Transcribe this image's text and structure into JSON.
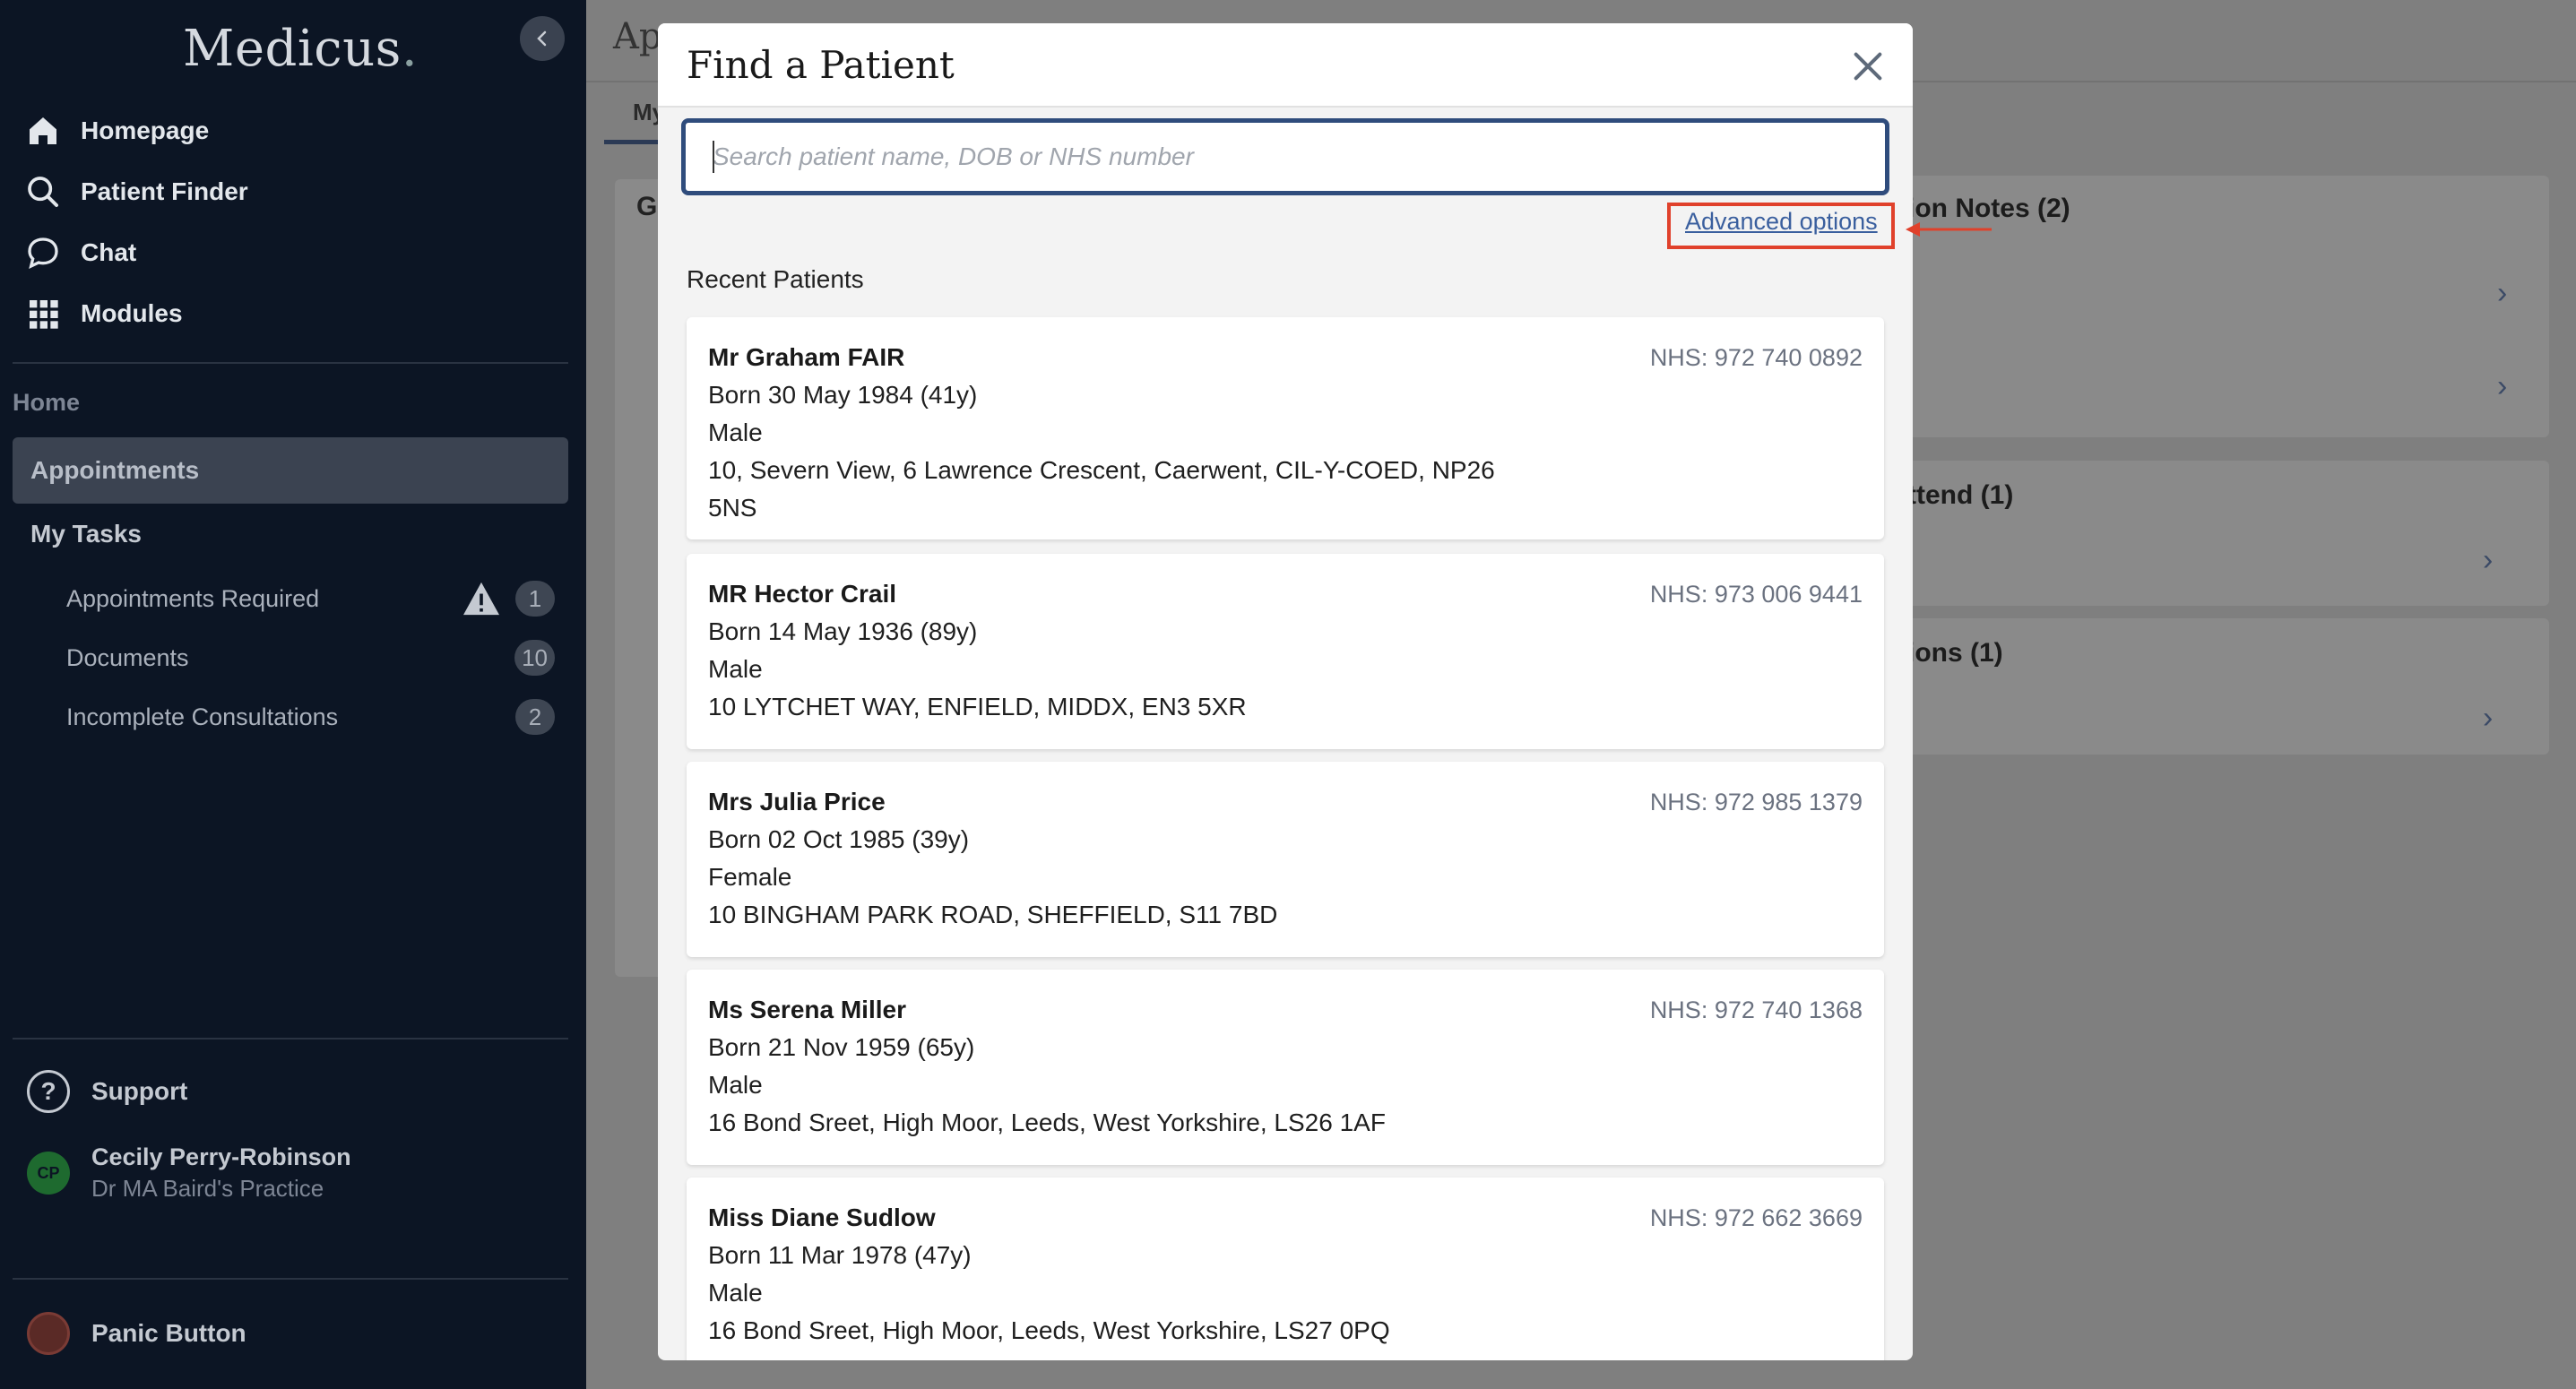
{
  "sidebar": {
    "logo": "Medicus",
    "logo_dot": ".",
    "nav": [
      {
        "label": "Homepage",
        "icon": "home-icon"
      },
      {
        "label": "Patient Finder",
        "icon": "search-icon"
      },
      {
        "label": "Chat",
        "icon": "chat-icon"
      },
      {
        "label": "Modules",
        "icon": "grid-icon"
      }
    ],
    "section_home": "Home",
    "active_item": "Appointments",
    "tasks_heading": "My Tasks",
    "tasks": [
      {
        "label": "Appointments Required",
        "count": "1"
      },
      {
        "label": "Documents",
        "count": "10"
      },
      {
        "label": "Incomplete Consultations",
        "count": "2"
      }
    ],
    "support": "Support",
    "user": {
      "initials": "CP",
      "name": "Cecily Perry-Robinson",
      "practice": "Dr MA Baird's Practice"
    },
    "panic": "Panic Button"
  },
  "background": {
    "title": "Ap",
    "tab": "My",
    "left_card_initial": "G",
    "cards": [
      {
        "title": "ion Notes (2)"
      },
      {
        "title": "ttend (1)"
      },
      {
        "title": "ions (1)"
      }
    ]
  },
  "modal": {
    "title": "Find a Patient",
    "search_placeholder": "Search patient name, DOB or NHS number",
    "advanced_options": "Advanced options",
    "recent_label": "Recent Patients",
    "patients": [
      {
        "name": "Mr Graham FAIR",
        "nhs": "NHS: 972 740 0892",
        "born": "Born 30 May 1984 (41y)",
        "gender": "Male",
        "address": "10, Severn View, 6 Lawrence Crescent, Caerwent, CIL-Y-COED, NP26 5NS"
      },
      {
        "name": "MR Hector Crail",
        "nhs": "NHS: 973 006 9441",
        "born": "Born 14 May 1936 (89y)",
        "gender": "Male",
        "address": "10 LYTCHET WAY, ENFIELD, MIDDX, EN3 5XR"
      },
      {
        "name": "Mrs Julia Price",
        "nhs": "NHS: 972 985 1379",
        "born": "Born 02 Oct 1985 (39y)",
        "gender": "Female",
        "address": "10 BINGHAM PARK ROAD, SHEFFIELD, S11 7BD"
      },
      {
        "name": "Ms Serena Miller",
        "nhs": "NHS: 972 740 1368",
        "born": "Born 21 Nov 1959 (65y)",
        "gender": "Male",
        "address": "16 Bond Sreet, High Moor, Leeds, West Yorkshire, LS26 1AF"
      },
      {
        "name": "Miss Diane Sudlow",
        "nhs": "NHS: 972 662 3669",
        "born": "Born 11 Mar 1978 (47y)",
        "gender": "Male",
        "address": "16 Bond Sreet, High Moor, Leeds, West Yorkshire, LS27 0PQ"
      }
    ]
  },
  "colors": {
    "sidebar_bg": "#0c1524",
    "search_border": "#2f4c7c",
    "link": "#3a5f9e",
    "annotation": "#e0412b"
  }
}
